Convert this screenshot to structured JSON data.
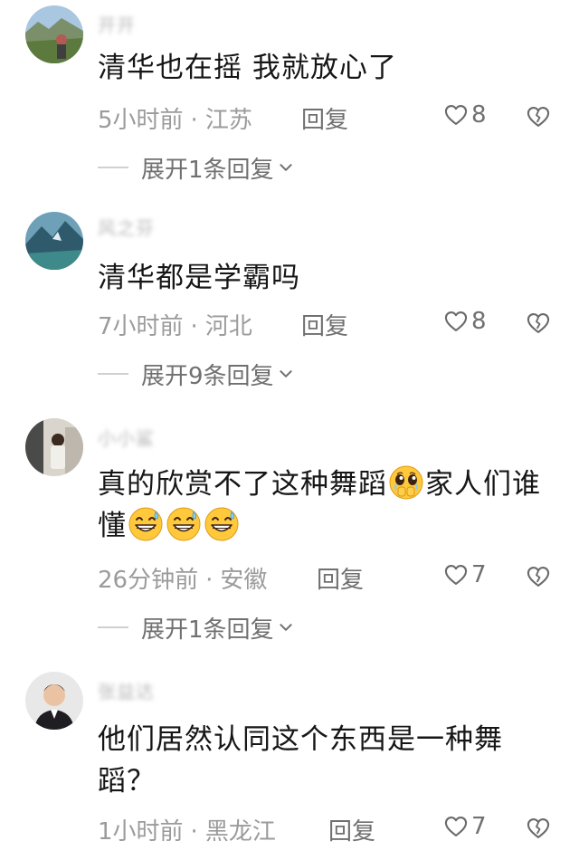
{
  "comments": [
    {
      "username": "开开",
      "text": "清华也在摇 我就放心了",
      "time": "5小时前",
      "location": "江苏",
      "reply_label": "回复",
      "likes": "8",
      "expand_label": "展开1条回复"
    },
    {
      "username": "风之芬",
      "text": "清华都是学霸吗",
      "time": "7小时前",
      "location": "河北",
      "reply_label": "回复",
      "likes": "8",
      "expand_label": "展开9条回复"
    },
    {
      "username": "小小鲨",
      "text_part1": "真的欣赏不了这种舞蹈",
      "text_part2": "家人们谁懂",
      "time": "26分钟前",
      "location": "安徽",
      "reply_label": "回复",
      "likes": "7",
      "expand_label": "展开1条回复"
    },
    {
      "username": "张益达",
      "text": "他们居然认同这个东西是一种舞蹈？",
      "time": "1小时前",
      "location": "黑龙江",
      "reply_label": "回复",
      "likes": "7"
    }
  ],
  "meta_separator": "·",
  "icons": {
    "like": "heart-outline-icon",
    "dislike": "broken-heart-icon",
    "expand": "chevron-down-icon",
    "emoji_1": "pleading-face-emoji",
    "emoji_2": "grinning-sweat-emoji"
  },
  "colors": {
    "text": "#161616",
    "meta": "#9b9b9b",
    "action": "#707070"
  }
}
